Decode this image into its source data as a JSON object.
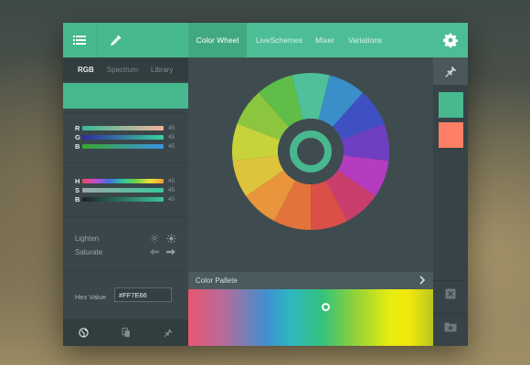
{
  "colors": {
    "accent": "#4dbd96",
    "panel_dark": "#3a4649",
    "swatch_primary": "#48b88f",
    "swatch_secondary": "#ff7e66"
  },
  "toolbar": {
    "menu_icon": "menu-icon",
    "picker_icon": "eyedropper-icon",
    "settings_icon": "gear-icon"
  },
  "tabs": [
    {
      "label": "Color Wheel",
      "active": true
    },
    {
      "label": "LiveSchemes",
      "active": false
    },
    {
      "label": "Mixer",
      "active": false
    },
    {
      "label": "Variations",
      "active": false
    }
  ],
  "subtabs": [
    {
      "label": "RGB",
      "active": true
    },
    {
      "label": "Spectrum",
      "active": false
    },
    {
      "label": "Library",
      "active": false
    }
  ],
  "rgb_sliders": [
    {
      "label": "R",
      "value": "45"
    },
    {
      "label": "G",
      "value": "45"
    },
    {
      "label": "B",
      "value": "45"
    }
  ],
  "hsb_sliders": [
    {
      "label": "H",
      "value": "45"
    },
    {
      "label": "S",
      "value": "45"
    },
    {
      "label": "B",
      "value": "45"
    }
  ],
  "adjust": [
    {
      "label": "Lighten",
      "icon_a": "sun-dim-icon",
      "icon_b": "sun-bright-icon"
    },
    {
      "label": "Saturate",
      "icon_a": "arrow-left-icon",
      "icon_b": "arrow-right-icon"
    }
  ],
  "hex": {
    "label": "Hex Value",
    "value": "#FF7E66"
  },
  "bottom_tabs": [
    "globe-icon",
    "copy-icon",
    "pin-icon"
  ],
  "palette": {
    "title": "Color Pallete",
    "marker_position": 0.56
  },
  "wheel": {
    "segments": [
      "#4ec09a",
      "#3b8fc9",
      "#3f50c3",
      "#6e3fc0",
      "#b43cbf",
      "#c93e6d",
      "#da4f47",
      "#e2733d",
      "#e8953c",
      "#dec43c",
      "#c8d23a",
      "#8cc63e",
      "#5ebe47"
    ],
    "center_ring": "#48b88f"
  },
  "right_panel": {
    "pin_icon": "pin-icon",
    "swatches": [
      "#48b88f",
      "#ff7e66"
    ],
    "close_icon": "close-icon",
    "add_icon": "add-folder-icon"
  }
}
